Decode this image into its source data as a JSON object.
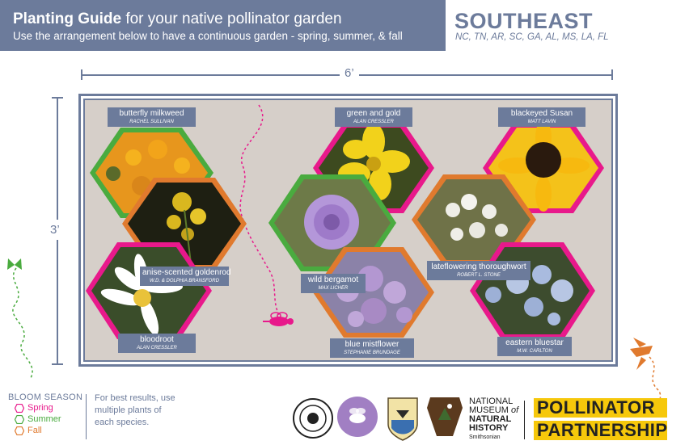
{
  "header": {
    "title_bold": "Planting Guide",
    "title_rest": " for your native pollinator garden",
    "subtitle": "Use the arrangement below to have a continuous garden - spring, summer, & fall",
    "region": "SOUTHEAST",
    "states": "NC, TN, AR, SC, GA, AL, MS, LA, FL"
  },
  "dimensions": {
    "width": "6’",
    "height": "3’"
  },
  "plants": [
    {
      "name": "butterfly milkweed",
      "credit": "RACHEL SULLIVAN",
      "season": "Summer"
    },
    {
      "name": "anise-scented goldenrod",
      "credit": "W.D. & DOLPHIA BRANSFORD",
      "season": "Fall"
    },
    {
      "name": "bloodroot",
      "credit": "ALAN CRESSLER",
      "season": "Spring"
    },
    {
      "name": "green and gold",
      "credit": "ALAN CRESSLER",
      "season": "Spring"
    },
    {
      "name": "wild bergamot",
      "credit": "MAX LICHER",
      "season": "Summer"
    },
    {
      "name": "blue mistflower",
      "credit": "STEPHANIE BRUNDAGE",
      "season": "Fall"
    },
    {
      "name": "blackeyed Susan",
      "credit": "MATT LAVIN",
      "season": "Spring"
    },
    {
      "name": "lateflowering thoroughwort",
      "credit": "ROBERT L. STONE",
      "season": "Fall"
    },
    {
      "name": "eastern bluestar",
      "credit": "M.W. CARLTON",
      "season": "Spring"
    }
  ],
  "legend": {
    "title": "BLOOM SEASON",
    "items": [
      {
        "label": "Spring",
        "color": "#e8198b"
      },
      {
        "label": "Summer",
        "color": "#4aab3f"
      },
      {
        "label": "Fall",
        "color": "#e07a2e"
      }
    ]
  },
  "tip": "For best results, use multiple plants of each species.",
  "logos": {
    "museum_line1": "NATIONAL",
    "museum_line2": "MUSEUM",
    "museum_of": "of",
    "museum_line3": "NATURAL",
    "museum_line4": "HISTORY",
    "museum_smithsonian": "Smithsonian",
    "pp_line1": "POLLINATOR",
    "pp_line2": "PARTNERSHIP"
  },
  "colors": {
    "spring": "#e8198b",
    "summer": "#4aab3f",
    "fall": "#e07a2e",
    "slate": "#6c7b9b",
    "bed": "#d6cfc9"
  }
}
